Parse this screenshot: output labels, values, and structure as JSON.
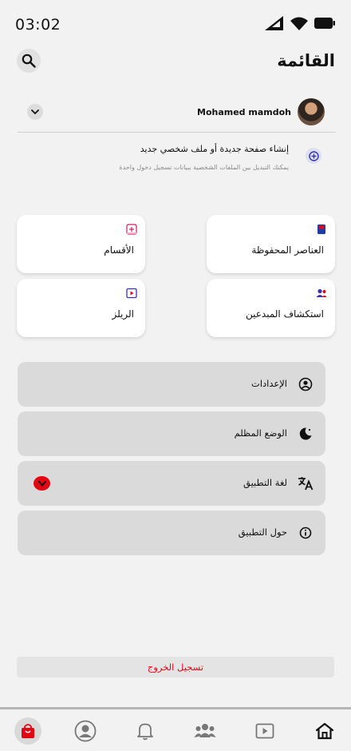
{
  "status_bar": {
    "time": "03:02"
  },
  "header": {
    "title": "القائمة"
  },
  "profile": {
    "name": "Mohamed mamdoh"
  },
  "create_account": {
    "title": "إنشاء صفحة جديدة أو ملف شخصي جديد",
    "subtitle": "يمكنك التبديل بين الملفات الشخصية ببيانات تسجيل دخول واحدة"
  },
  "shortcuts": [
    {
      "label": "العناصر المحفوظة",
      "icon": "saved-flag-icon",
      "color": "#1a3da6"
    },
    {
      "label": "الأقسام",
      "icon": "sections-icon",
      "color": "#d11a6b"
    },
    {
      "label": "استكشاف المبدعين",
      "icon": "creators-icon",
      "color": "#3b2fb5"
    },
    {
      "label": "الريلز",
      "icon": "reels-icon",
      "color": "#3b2fb5"
    }
  ],
  "menu": [
    {
      "label": "الإعدادات",
      "icon": "settings-user-icon"
    },
    {
      "label": "الوضع المظلم",
      "icon": "dark-mode-icon"
    },
    {
      "label": "لغة التطبيق",
      "icon": "translate-icon"
    },
    {
      "label": "حول التطبيق",
      "icon": "info-icon"
    }
  ],
  "logout": {
    "label": "تسجيل الخروج"
  },
  "tabbar": {
    "items": [
      "shop-bag-icon",
      "profile-icon",
      "bell-icon",
      "group-icon",
      "video-icon",
      "home-icon"
    ],
    "active": "shop-bag-icon"
  },
  "colors": {
    "accent": "#e30613",
    "background": "#f2f2f2",
    "menu_bg": "#dadada"
  }
}
